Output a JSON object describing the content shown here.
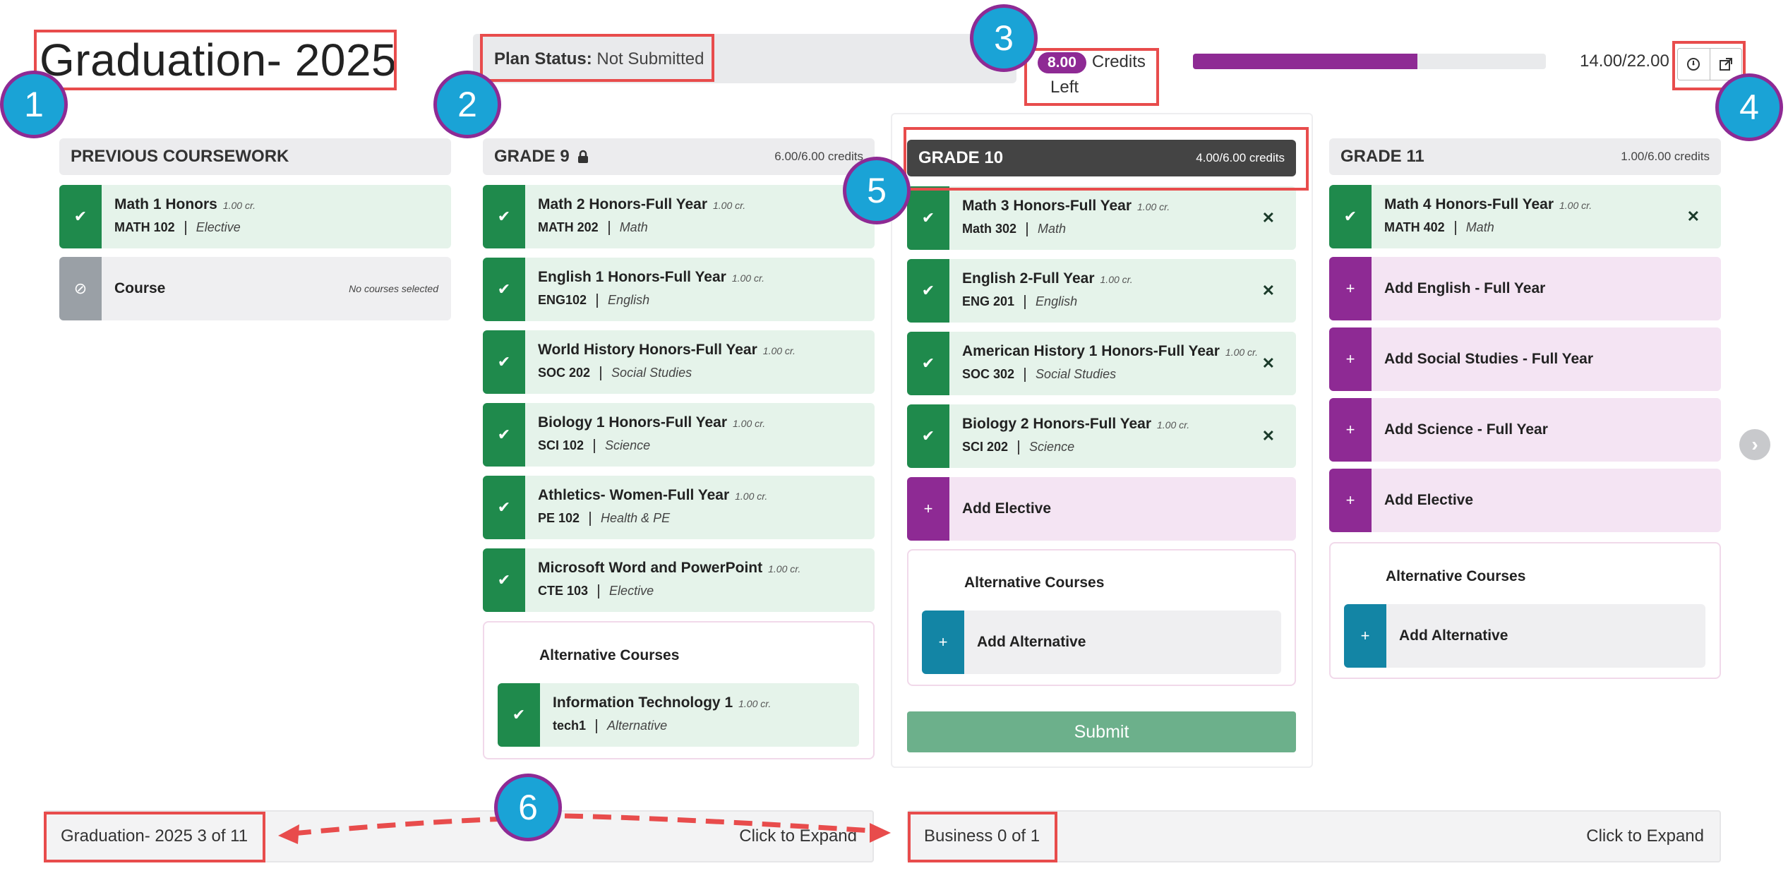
{
  "header": {
    "title": "Graduation- 2025",
    "plan_status_label": "Plan Status:",
    "plan_status_value": "Not Submitted",
    "credits_left_value": "8.00",
    "credits_left_label1": "Credits",
    "credits_left_label2": "Left",
    "progress_text": "14.00/22.00",
    "progress_fraction": 0.636,
    "icons": [
      "history-icon",
      "external-link-icon"
    ]
  },
  "colors": {
    "purple": "#8e2a94",
    "green": "#1f8a4c",
    "teal": "#1385a5",
    "annotation_red": "#e84c4c",
    "badge_blue": "#1aa3d6"
  },
  "annotations": [
    "1",
    "2",
    "3",
    "4",
    "5",
    "6"
  ],
  "previous": {
    "title": "PREVIOUS COURSEWORK",
    "courses": [
      {
        "name": "Math 1 Honors",
        "cr": "1.00 cr.",
        "code": "MATH 102",
        "cat": "Elective"
      }
    ],
    "empty": {
      "label": "Course",
      "note": "No courses selected"
    }
  },
  "grade9": {
    "title": "GRADE 9",
    "credits": "6.00/6.00 credits",
    "courses": [
      {
        "name": "Math 2 Honors-Full Year",
        "cr": "1.00 cr.",
        "code": "MATH 202",
        "cat": "Math"
      },
      {
        "name": "English 1 Honors-Full Year",
        "cr": "1.00 cr.",
        "code": "ENG102",
        "cat": "English"
      },
      {
        "name": "World History Honors-Full Year",
        "cr": "1.00 cr.",
        "code": "SOC 202",
        "cat": "Social Studies"
      },
      {
        "name": "Biology 1 Honors-Full Year",
        "cr": "1.00 cr.",
        "code": "SCI 102",
        "cat": "Science"
      },
      {
        "name": "Athletics- Women-Full Year",
        "cr": "1.00 cr.",
        "code": "PE 102",
        "cat": "Health & PE"
      },
      {
        "name": "Microsoft Word and PowerPoint",
        "cr": "1.00 cr.",
        "code": "CTE 103",
        "cat": "Elective"
      }
    ],
    "alt_title": "Alternative Courses",
    "alt_course": {
      "name": "Information Technology 1",
      "cr": "1.00 cr.",
      "code": "tech1",
      "cat": "Alternative"
    }
  },
  "grade10": {
    "title": "GRADE 10",
    "credits": "4.00/6.00 credits",
    "courses": [
      {
        "name": "Math 3 Honors-Full Year",
        "cr": "1.00 cr.",
        "code": "Math 302",
        "cat": "Math"
      },
      {
        "name": "English 2-Full Year",
        "cr": "1.00 cr.",
        "code": "ENG 201",
        "cat": "English"
      },
      {
        "name": "American History 1 Honors-Full Year",
        "cr": "1.00 cr.",
        "code": "SOC 302",
        "cat": "Social Studies"
      },
      {
        "name": "Biology 2 Honors-Full Year",
        "cr": "1.00 cr.",
        "code": "SCI 202",
        "cat": "Science"
      }
    ],
    "add_elective": "Add Elective",
    "alt_title": "Alternative Courses",
    "add_alternative": "Add Alternative",
    "submit": "Submit"
  },
  "grade11": {
    "title": "GRADE 11",
    "credits": "1.00/6.00 credits",
    "courses": [
      {
        "name": "Math 4 Honors-Full Year",
        "cr": "1.00 cr.",
        "code": "MATH 402",
        "cat": "Math"
      }
    ],
    "adds": [
      "Add English - Full Year",
      "Add Social Studies - Full Year",
      "Add Science - Full Year",
      "Add Elective"
    ],
    "alt_title": "Alternative Courses",
    "add_alternative": "Add Alternative"
  },
  "footer": {
    "left_label": "Graduation- 2025 3 of 11",
    "left_expand": "Click to Expand",
    "right_label": "Business 0 of 1",
    "right_expand": "Click to Expand"
  }
}
